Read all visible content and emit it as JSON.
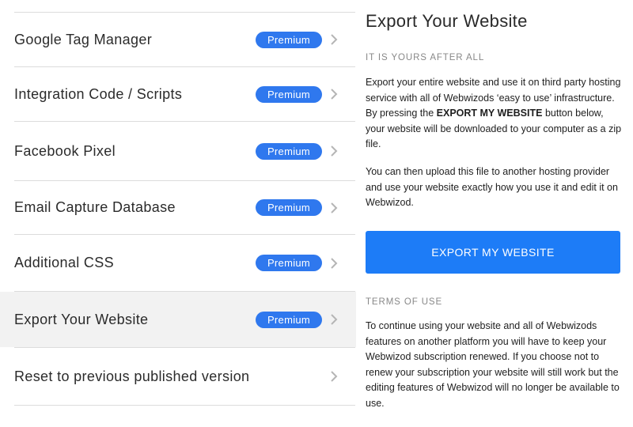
{
  "settings_list": {
    "items": [
      {
        "label": "Google Tag Manager",
        "badge": "Premium"
      },
      {
        "label": "Integration Code / Scripts",
        "badge": "Premium"
      },
      {
        "label": "Facebook Pixel",
        "badge": "Premium"
      },
      {
        "label": "Email Capture Database",
        "badge": "Premium"
      },
      {
        "label": "Additional CSS",
        "badge": "Premium"
      },
      {
        "label": "Export Your Website",
        "badge": "Premium",
        "active": true
      },
      {
        "label": "Reset to previous published version"
      }
    ]
  },
  "panel": {
    "title": "Export Your Website",
    "subtitle": "IT IS YOURS AFTER ALL",
    "intro_before_bold": "Export your entire website and use it on third party hosting service with all of Webwizods ‘easy to use’ infrastructure. By pressing the ",
    "intro_bold": "EXPORT MY WEBSITE",
    "intro_after_bold": " button below, your website will be downloaded to your computer as a zip file.",
    "upload_text": "You can then upload this file to another hosting provider and use your website exactly how you use it and edit it on Webwizod.",
    "export_button": "EXPORT MY WEBSITE",
    "terms_label": "TERMS OF USE",
    "terms_text": "To continue using your website and all of Webwizods features on another platform you will have to keep your Webwizod subscription renewed. If you choose not to renew your subscription your website will still work but the editing features of Webwizod will no longer be available to use."
  },
  "colors": {
    "badge": "#2f78ee",
    "button": "#1d7cf7",
    "active_row": "#f2f2f2",
    "chevron": "#b5b5b5"
  }
}
